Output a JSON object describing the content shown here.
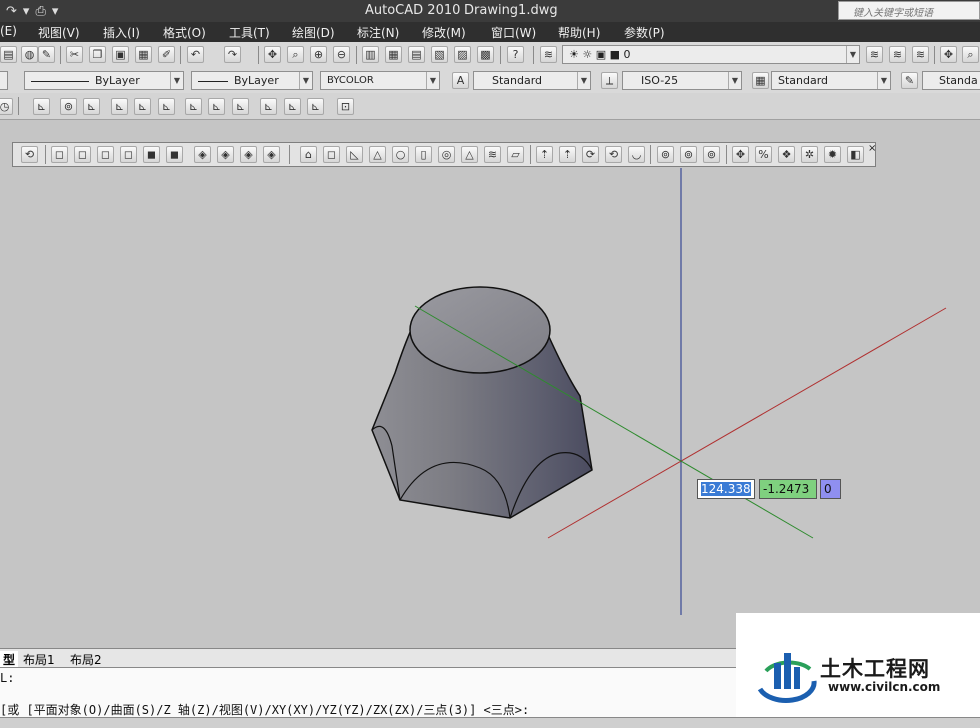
{
  "window": {
    "app_title": "AutoCAD 2010",
    "drawing_title": "Drawing1.dwg"
  },
  "help_search": {
    "placeholder": "键入关键字或短语"
  },
  "menu": [
    "(E)",
    "视图(V)",
    "插入(I)",
    "格式(O)",
    "工具(T)",
    "绘图(D)",
    "标注(N)",
    "修改(M)",
    "窗口(W)",
    "帮助(H)",
    "参数(P)"
  ],
  "layer": {
    "current": "0"
  },
  "properties": {
    "color": "ByLayer",
    "linetype": "ByLayer",
    "lineweight": "BYCOLOR"
  },
  "styles": {
    "text_style": "Standard",
    "dim_style": "ISO-25",
    "table_style": "Standard",
    "multileader_style": "Standa"
  },
  "dynamic_input": {
    "x": "124.338",
    "y": "-1.2473",
    "z": "0"
  },
  "layout_tabs": [
    "型",
    "布局1",
    "布局2"
  ],
  "command": {
    "line1": "L:",
    "line2": "[或 [平面对象(O)/曲面(S)/Z 轴(Z)/视图(V)/XY(XY)/YZ(YZ)/ZX(ZX)/三点(3)] <三点>:"
  },
  "watermark": {
    "name": "土木工程网",
    "url": "www.civilcn.com"
  },
  "colors": {
    "title_bg": "#3b3b3b",
    "viewport_bg": "#c5c5c5",
    "x_axis": "#b03030",
    "y_axis": "#2e8b2e",
    "z_axis": "#1c2e8c"
  }
}
